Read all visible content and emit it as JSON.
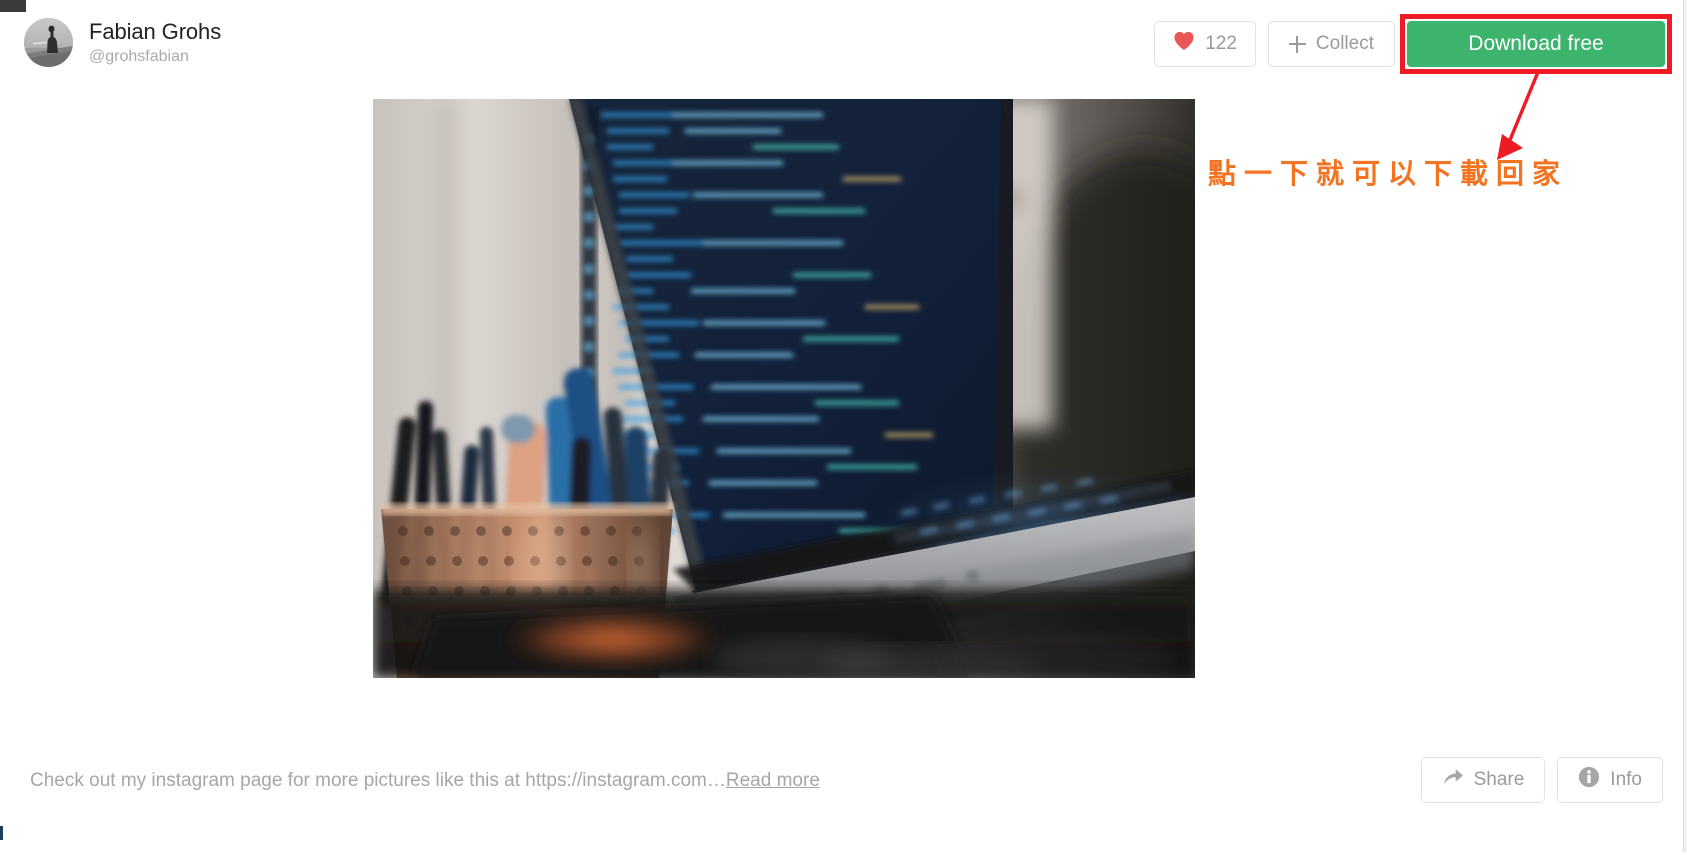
{
  "author": {
    "name": "Fabian Grohs",
    "handle": "@grohsfabian",
    "avatar_icon": "user-photo-avatar"
  },
  "header_actions": {
    "like": {
      "icon": "heart-icon",
      "count": "122",
      "color": "#eb5757"
    },
    "collect": {
      "icon": "plus-icon",
      "label": "Collect"
    },
    "download": {
      "label": "Download free",
      "color": "#3cb46e"
    }
  },
  "annotation": {
    "text": "點一下就可以下載回家",
    "text_color": "#f47320",
    "box_color": "#ed1c24",
    "arrow_icon": "arrow-pointing-down-left"
  },
  "photo": {
    "alt_name": "laptop-with-code-on-desk-photo",
    "description": "Desk scene with a wire mesh pen cup holding pens and pencils beside an open laptop displaying blue syntax-highlighted code"
  },
  "caption": {
    "text": "Check out my instagram page for more pictures like this at https://instagram.com…",
    "read_more_label": "Read more"
  },
  "bottom_actions": {
    "share": {
      "icon": "share-arrow-icon",
      "label": "Share"
    },
    "info": {
      "icon": "info-circle-icon",
      "label": "Info"
    }
  }
}
